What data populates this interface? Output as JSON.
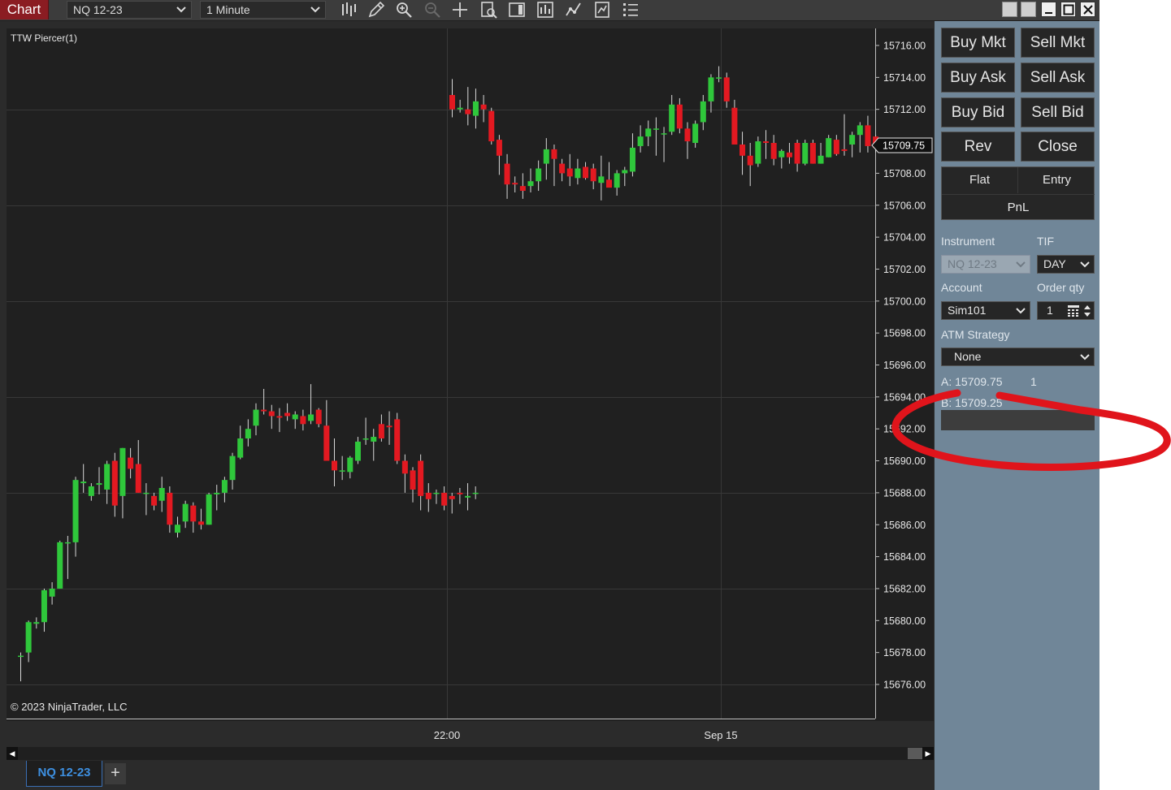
{
  "toolbar": {
    "chart_tab_label": "Chart",
    "instrument": "NQ 12-23",
    "interval": "1 Minute",
    "icons": [
      "bar-type-icon",
      "draw-tool-icon",
      "zoom-in-icon",
      "zoom-out-icon",
      "crosshair-icon",
      "data-box-icon",
      "chart-trader-icon",
      "indicators-icon",
      "strategies-icon",
      "properties-icon",
      "templates-icon"
    ],
    "window_buttons": [
      "tile-icon",
      "tile-icon",
      "minimize-icon",
      "maximize-icon",
      "close-icon"
    ]
  },
  "chart": {
    "indicator_label": "TTW Piercer(1)",
    "copyright": "© 2023 NinjaTrader, LLC",
    "price_axis": [
      "15716.00",
      "15714.00",
      "15712.00",
      "15710.00",
      "15708.00",
      "15706.00",
      "15704.00",
      "15702.00",
      "15700.00",
      "15698.00",
      "15696.00",
      "15694.00",
      "15692.00",
      "15690.00",
      "15688.00",
      "15686.00",
      "15684.00",
      "15682.00",
      "15680.00",
      "15678.00",
      "15676.00"
    ],
    "last_price": "15709.75",
    "time_labels": [
      {
        "label": "22:00"
      },
      {
        "label": "Sep 15"
      }
    ],
    "colors": {
      "up": "#2fc73b",
      "down": "#e31921",
      "wick": "#d8d8d8",
      "background": "#202020",
      "grid": "#383838"
    }
  },
  "chart_data": {
    "type": "candlestick",
    "title": "",
    "y_range": [
      15675.0,
      15717.0
    ],
    "x_labels": [
      "22:00",
      "Sep 15"
    ],
    "series": [
      {
        "segment": "before 22:00",
        "ohlc": [
          [
            15677.8,
            15678.0,
            15676.2,
            15677.8
          ],
          [
            15678.0,
            15680.0,
            15677.4,
            15679.9
          ],
          [
            15679.8,
            15680.2,
            15679.5,
            15679.9
          ],
          [
            15679.9,
            15682.0,
            15679.3,
            15681.9
          ],
          [
            15681.5,
            15682.4,
            15681.0,
            15682.0
          ],
          [
            15682.0,
            15685.0,
            15682.0,
            15684.9
          ],
          [
            15684.9,
            15685.3,
            15682.6,
            15684.9
          ],
          [
            15684.9,
            15689.0,
            15684.0,
            15688.8
          ],
          [
            15688.6,
            15689.8,
            15688.0,
            15688.7
          ],
          [
            15687.8,
            15688.6,
            15687.5,
            15688.4
          ],
          [
            15688.5,
            15689.6,
            15687.9,
            15688.6
          ],
          [
            15688.2,
            15690.0,
            15687.3,
            15689.8
          ],
          [
            15690.0,
            15690.5,
            15686.5,
            15687.2
          ],
          [
            15687.8,
            15690.8,
            15686.4,
            15690.8
          ],
          [
            15690.2,
            15690.8,
            15688.9,
            15689.5
          ],
          [
            15689.8,
            15691.3,
            15688.0,
            15688.0
          ],
          [
            15688.0,
            15688.6,
            15686.6,
            15688.0
          ],
          [
            15687.8,
            15688.0,
            15686.9,
            15687.2
          ],
          [
            15687.5,
            15689.0,
            15686.8,
            15688.3
          ],
          [
            15688.0,
            15688.4,
            15685.5,
            15686.0
          ],
          [
            15685.5,
            15686.5,
            15685.2,
            15686.0
          ],
          [
            15686.2,
            15687.5,
            15685.8,
            15687.3
          ],
          [
            15687.2,
            15687.4,
            15685.5,
            15686.2
          ],
          [
            15686.2,
            15687.0,
            15685.7,
            15686.0
          ],
          [
            15686.0,
            15688.0,
            15686.0,
            15687.9
          ],
          [
            15687.9,
            15688.5,
            15686.9,
            15688.0
          ],
          [
            15688.0,
            15689.0,
            15687.4,
            15688.8
          ],
          [
            15688.8,
            15690.5,
            15688.2,
            15690.3
          ],
          [
            15690.2,
            15692.2,
            15690.1,
            15691.4
          ],
          [
            15691.4,
            15692.6,
            15690.9,
            15692.0
          ],
          [
            15692.2,
            15693.6,
            15691.6,
            15693.2
          ],
          [
            15693.2,
            15694.5,
            15692.9,
            15693.1
          ],
          [
            15693.1,
            15693.5,
            15692.0,
            15692.8
          ],
          [
            15692.8,
            15693.3,
            15691.8,
            15692.7
          ],
          [
            15693.0,
            15693.6,
            15692.5,
            15692.8
          ],
          [
            15692.6,
            15693.1,
            15692.0,
            15692.9
          ],
          [
            15692.8,
            15693.2,
            15691.9,
            15692.3
          ],
          [
            15692.5,
            15694.8,
            15692.3,
            15692.9
          ],
          [
            15693.2,
            15693.3,
            15692.1,
            15692.3
          ],
          [
            15692.2,
            15693.8,
            15691.1,
            15690.0
          ],
          [
            15690.0,
            15691.4,
            15688.4,
            15689.4
          ],
          [
            15689.4,
            15690.3,
            15688.8,
            15689.4
          ],
          [
            15689.3,
            15690.3,
            15688.9,
            15690.2
          ],
          [
            15690.0,
            15691.5,
            15689.8,
            15691.2
          ],
          [
            15691.4,
            15692.7,
            15691.0,
            15691.4
          ],
          [
            15691.2,
            15692.0,
            15690.0,
            15691.5
          ],
          [
            15692.3,
            15692.9,
            15691.2,
            15691.4
          ],
          [
            15692.2,
            15693.1,
            15691.0,
            15692.1
          ],
          [
            15692.6,
            15693.0,
            15689.8,
            15690.0
          ],
          [
            15690.0,
            15690.4,
            15688.0,
            15689.2
          ],
          [
            15689.4,
            15689.6,
            15687.4,
            15688.2
          ],
          [
            15690.0,
            15690.4,
            15686.9,
            15687.8
          ],
          [
            15688.0,
            15688.6,
            15686.8,
            15687.6
          ],
          [
            15688.0,
            15688.2,
            15687.3,
            15688.0
          ],
          [
            15688.0,
            15688.4,
            15686.9,
            15687.2
          ],
          [
            15687.8,
            15688.0,
            15686.7,
            15687.6
          ],
          [
            15688.0,
            15688.3,
            15687.3,
            15687.9
          ],
          [
            15687.7,
            15688.6,
            15686.9,
            15687.8
          ],
          [
            15688.0,
            15688.4,
            15687.6,
            15688.0
          ]
        ]
      },
      {
        "segment": "after 22:00",
        "ohlc": [
          [
            15712.9,
            15713.9,
            15711.5,
            15712.0
          ],
          [
            15712.0,
            15712.6,
            15711.8,
            15712.1
          ],
          [
            15712.0,
            15713.4,
            15711.0,
            15711.7
          ],
          [
            15711.6,
            15713.3,
            15710.8,
            15712.5
          ],
          [
            15712.3,
            15712.9,
            15711.2,
            15712.0
          ],
          [
            15711.9,
            15712.1,
            15709.8,
            15710.0
          ],
          [
            15710.1,
            15710.4,
            15707.9,
            15709.1
          ],
          [
            15708.6,
            15709.2,
            15706.4,
            15707.3
          ],
          [
            15707.4,
            15707.8,
            15706.8,
            15707.3
          ],
          [
            15707.2,
            15708.0,
            15706.4,
            15706.9
          ],
          [
            15707.2,
            15708.3,
            15706.8,
            15707.5
          ],
          [
            15707.5,
            15708.8,
            15706.9,
            15708.3
          ],
          [
            15708.6,
            15710.2,
            15707.6,
            15709.5
          ],
          [
            15709.5,
            15709.8,
            15707.2,
            15708.9
          ],
          [
            15708.6,
            15708.9,
            15707.5,
            15708.0
          ],
          [
            15708.3,
            15709.2,
            15707.2,
            15707.8
          ],
          [
            15707.7,
            15708.9,
            15707.3,
            15708.3
          ],
          [
            15708.4,
            15708.7,
            15707.6,
            15707.7
          ],
          [
            15708.3,
            15708.6,
            15707.0,
            15707.5
          ],
          [
            15707.4,
            15709.1,
            15706.3,
            15707.8
          ],
          [
            15707.6,
            15708.7,
            15707.2,
            15707.1
          ],
          [
            15707.1,
            15708.2,
            15706.6,
            15708.0
          ],
          [
            15708.0,
            15708.4,
            15707.2,
            15708.2
          ],
          [
            15708.1,
            15710.5,
            15707.8,
            15709.6
          ],
          [
            15709.7,
            15711.0,
            15709.3,
            15710.3
          ],
          [
            15710.3,
            15711.3,
            15709.7,
            15710.8
          ],
          [
            15710.8,
            15711.5,
            15709.1,
            15710.8
          ],
          [
            15710.5,
            15710.9,
            15708.7,
            15710.5
          ],
          [
            15710.6,
            15712.9,
            15710.4,
            15712.3
          ],
          [
            15712.3,
            15712.7,
            15710.5,
            15710.8
          ],
          [
            15710.8,
            15711.2,
            15708.9,
            15710.0
          ],
          [
            15709.9,
            15711.3,
            15709.6,
            15711.1
          ],
          [
            15711.2,
            15712.9,
            15710.7,
            15712.5
          ],
          [
            15712.5,
            15714.2,
            15711.8,
            15714.0
          ],
          [
            15714.0,
            15714.7,
            15713.7,
            15714.0
          ],
          [
            15714.0,
            15714.3,
            15712.1,
            15712.5
          ],
          [
            15712.1,
            15712.6,
            15710.0,
            15709.8
          ],
          [
            15709.8,
            15710.6,
            15707.9,
            15709.1
          ],
          [
            15709.1,
            15709.9,
            15707.2,
            15708.5
          ],
          [
            15708.6,
            15710.3,
            15708.4,
            15710.0
          ],
          [
            15710.0,
            15710.7,
            15708.9,
            15709.9
          ],
          [
            15709.9,
            15710.4,
            15708.5,
            15708.9
          ],
          [
            15709.0,
            15709.5,
            15708.3,
            15709.4
          ],
          [
            15709.3,
            15709.9,
            15708.6,
            15709.0
          ],
          [
            15709.9,
            15710.1,
            15708.1,
            15708.6
          ],
          [
            15708.6,
            15710.1,
            15708.5,
            15709.9
          ],
          [
            15709.9,
            15710.1,
            15708.6,
            15708.6
          ],
          [
            15708.6,
            15709.9,
            15708.6,
            15709.1
          ],
          [
            15709.0,
            15710.4,
            15709.0,
            15710.2
          ],
          [
            15710.1,
            15710.4,
            15709.1,
            15709.2
          ],
          [
            15709.5,
            15711.7,
            15709.1,
            15709.4
          ],
          [
            15709.8,
            15710.6,
            15709.0,
            15710.4
          ],
          [
            15710.4,
            15711.2,
            15709.3,
            15711.0
          ],
          [
            15711.0,
            15711.6,
            15709.3,
            15709.7
          ],
          [
            15710.3,
            15710.4,
            15709.3,
            15709.6
          ],
          [
            15709.8,
            15709.9,
            15709.6,
            15709.75
          ]
        ]
      }
    ]
  },
  "navigator": {
    "left_arrow": "◀",
    "right_arrow": "▶"
  },
  "bottom_tabs": {
    "active_tab": "NQ 12-23",
    "add_tab": "+"
  },
  "order_panel": {
    "buttons": [
      {
        "label": "Buy Mkt"
      },
      {
        "label": "Sell Mkt"
      },
      {
        "label": "Buy Ask"
      },
      {
        "label": "Sell Ask"
      },
      {
        "label": "Buy Bid"
      },
      {
        "label": "Sell Bid"
      },
      {
        "label": "Rev"
      },
      {
        "label": "Close"
      }
    ],
    "position": {
      "flat": "Flat",
      "entry": "Entry",
      "pnl": "PnL"
    },
    "instrument_label": "Instrument",
    "instrument_value": "NQ 12-23",
    "tif_label": "TIF",
    "tif_value": "DAY",
    "account_label": "Account",
    "account_value": "Sim101",
    "qty_label": "Order qty",
    "qty_value": "1",
    "atm_label": "ATM Strategy",
    "atm_value": "None",
    "ask_line": "A: 15709.75",
    "ask_size": "1",
    "bid_line": "B:  15709.25"
  },
  "annotation": {
    "color": "#e0141b",
    "description": "red hand-drawn ellipse around bid/ask area"
  }
}
